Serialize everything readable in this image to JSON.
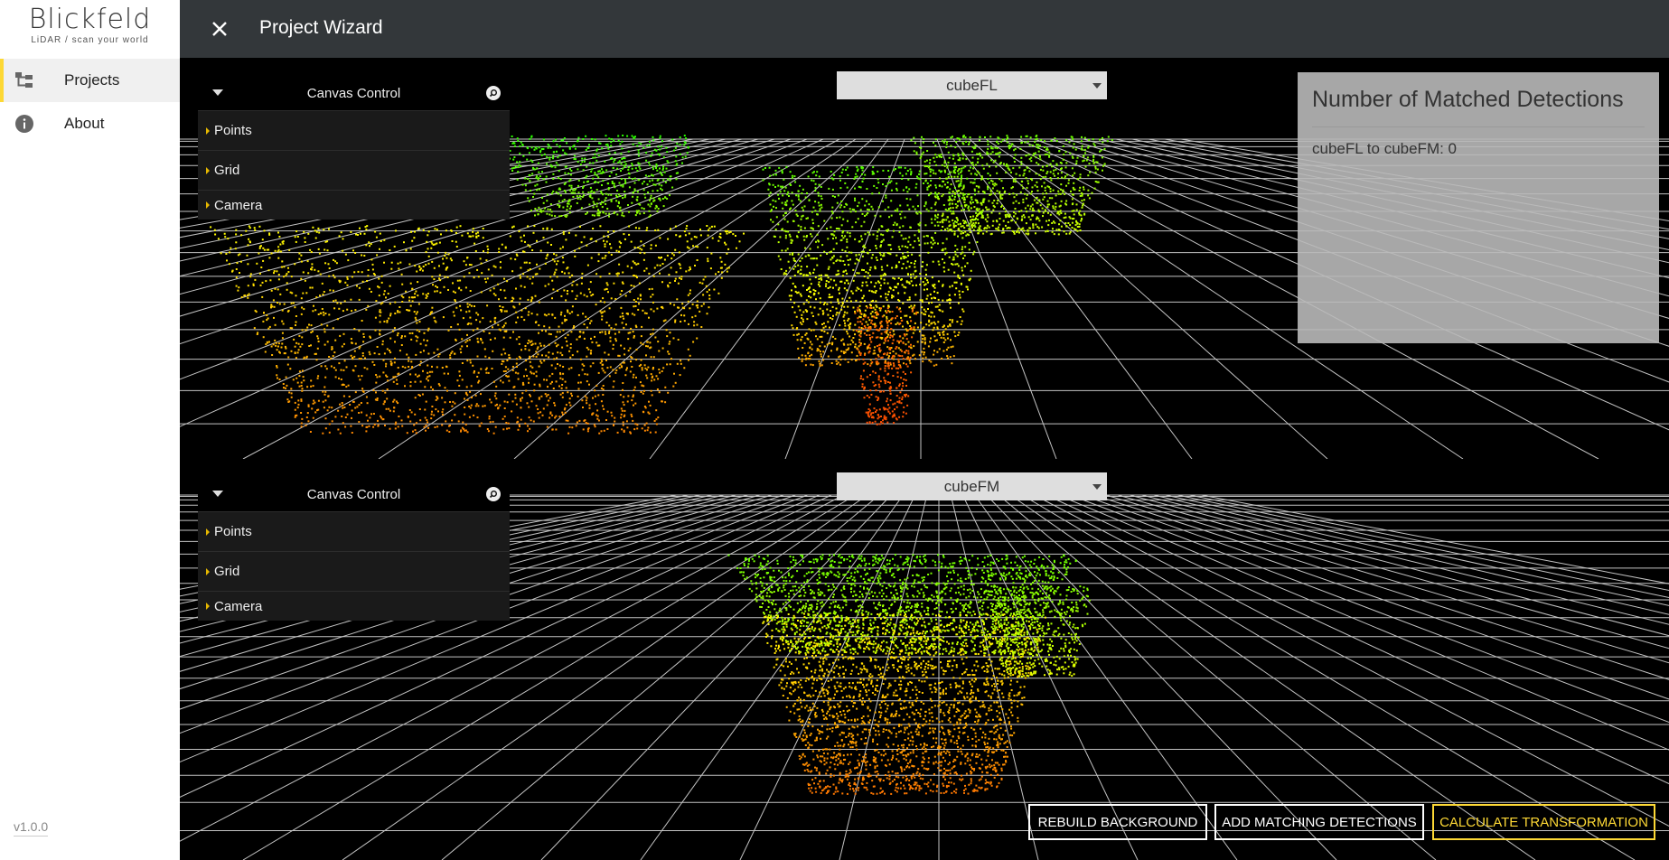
{
  "sidebar": {
    "logo_text": "Blickfeld",
    "logo_tagline": "LiDAR / scan your world",
    "items": [
      {
        "label": "Projects",
        "icon": "project-tree-icon"
      },
      {
        "label": "About",
        "icon": "info-icon"
      }
    ],
    "version": "v1.0.0"
  },
  "header": {
    "title": "Project Wizard",
    "close_icon": "close-icon"
  },
  "viewports": [
    {
      "device": "cubeFL",
      "canvas_control": {
        "title": "Canvas Control",
        "items": [
          "Points",
          "Grid",
          "Camera"
        ]
      }
    },
    {
      "device": "cubeFM",
      "canvas_control": {
        "title": "Canvas Control",
        "items": [
          "Points",
          "Grid",
          "Camera"
        ]
      }
    }
  ],
  "match_panel": {
    "title": "Number of Matched Detections",
    "entries": [
      "cubeFL to cubeFM: 0"
    ]
  },
  "actions": {
    "rebuild": "REBUILD BACKGROUND",
    "add_matching": "ADD MATCHING DETECTIONS",
    "calculate": "CALCULATE TRANSFORMATION"
  },
  "colors": {
    "accent": "#fdd835",
    "topbar": "#33373a",
    "sidebar_bg": "#ffffff",
    "viewport_bg": "#000000"
  }
}
